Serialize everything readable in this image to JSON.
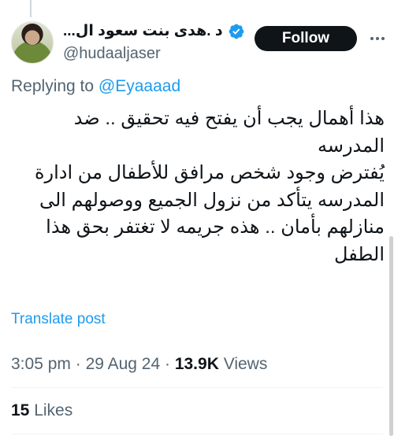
{
  "author": {
    "display_name": "د .هدى بنت سعود ال...",
    "handle": "@hudaaljaser",
    "verified": true,
    "verified_color": "#1d9bf0"
  },
  "actions": {
    "follow_label": "Follow",
    "more_icon": "more-horizontal-icon"
  },
  "reply": {
    "prefix": "Replying to ",
    "mention": "@Eyaaaad"
  },
  "tweet": {
    "lines": [
      "هذا أهمال يجب أن يفتح فيه تحقيق .. ضد",
      "المدرسه",
      "يُفترض وجود شخص مرافق للأطفال من ادارة",
      "المدرسه يتأكد من نزول الجميع ووصولهم الى",
      "منازلهم بأمان .. هذه جريمه لا تغتفر بحق هذا",
      "الطفل"
    ]
  },
  "translate_label": "Translate post",
  "meta": {
    "time": "3:05 pm",
    "separator": " · ",
    "date": "29 Aug 24",
    "views_count": "13.9K",
    "views_label": " Views"
  },
  "engagement": {
    "likes_count": "15",
    "likes_label": " Likes"
  },
  "colors": {
    "accent": "#1d9bf0",
    "text": "#0f1419",
    "secondary": "#536471"
  }
}
